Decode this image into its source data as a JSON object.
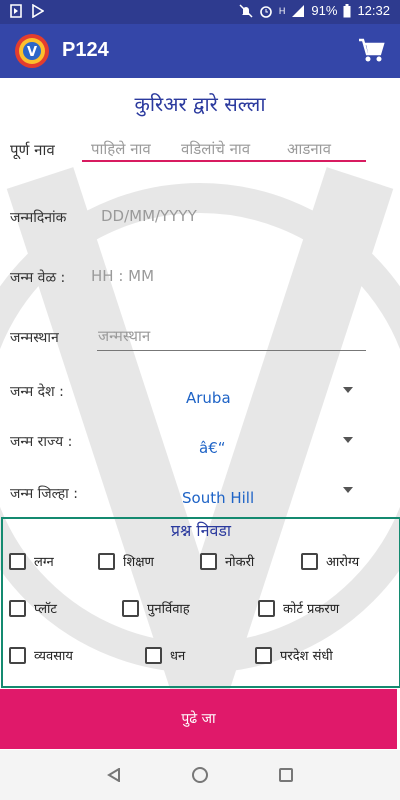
{
  "status_bar": {
    "battery": "91%",
    "time": "12:32",
    "network": "H"
  },
  "app_bar": {
    "title": "P124"
  },
  "form": {
    "title": "कुरिअर द्वारे सल्ला",
    "full_name_label": "पूर्ण नाव",
    "first_name_placeholder": "पाहिले नाव",
    "middle_name_placeholder": "वडिलांचे नाव",
    "last_name_placeholder": "आडनाव",
    "dob_label": "जन्मदिनांक",
    "dob_placeholder": "DD/MM/YYYY",
    "tob_label": "जन्म वेळ :",
    "tob_placeholder": "HH : MM",
    "birthplace_label": "जन्मस्थान",
    "birthplace_placeholder": "जन्मस्थान",
    "country_label": "जन्म देश :",
    "country_value": "Aruba",
    "state_label": "जन्म राज्य :",
    "state_value": "â€“",
    "district_label": "जन्म जिल्हा :",
    "district_value": "South Hill"
  },
  "questions": {
    "title": "प्रश्न निवडा",
    "options": [
      "लग्न",
      "शिक्षण",
      "नोकरी",
      "आरोग्य",
      "प्लॉट",
      "पुनर्विवाह",
      "कोर्ट प्रकरण",
      "व्यवसाय",
      "धन",
      "परदेश संधी"
    ]
  },
  "submit_label": "पुढे जा",
  "colors": {
    "status_bar": "#2e3b8f",
    "app_bar": "#3446a8",
    "accent": "#e0196a",
    "question_border": "#148a70",
    "title": "#2b3a9e",
    "spinner": "#1e63c6"
  },
  "icons": [
    "play-store-icon",
    "play-icon",
    "mute-icon",
    "alarm-icon",
    "signal-icon",
    "battery-icon",
    "cart-icon",
    "back-icon",
    "home-icon",
    "recent-apps-icon"
  ]
}
